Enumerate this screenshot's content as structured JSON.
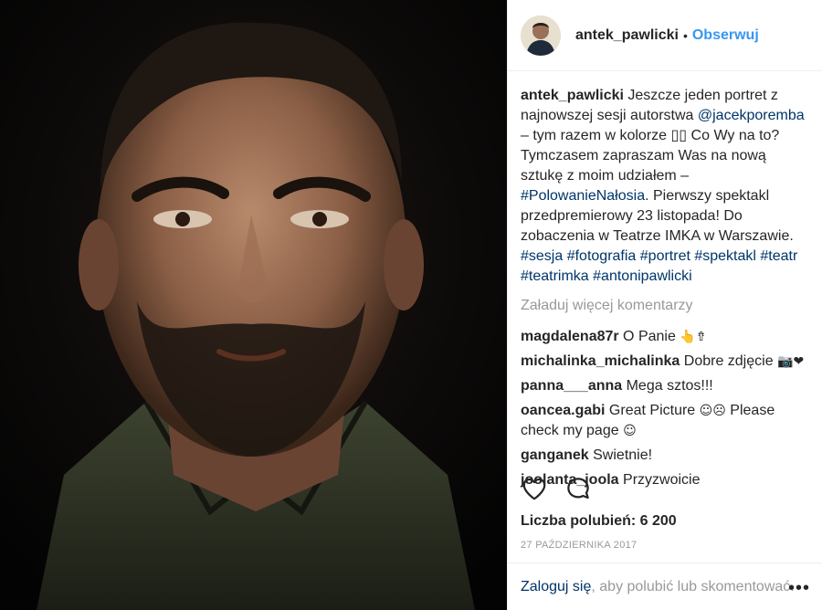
{
  "header": {
    "username": "antek_pawlicki",
    "separator": "•",
    "follow_label": "Obserwuj"
  },
  "caption": {
    "username": "antek_pawlicki",
    "text_1": " Jeszcze jeden portret z najnowszej sesji autorstwa ",
    "mention": "@jacekporemba",
    "text_2": " – tym razem w kolorze ▯▯ Co Wy na to? Tymczasem zapraszam Was na nową sztukę z moim udziałem – ",
    "hashtag_main": "#PolowanieNałosia",
    "text_3": ". Pierwszy spektakl przedpremierowy 23 listopada! Do zobaczenia w Teatrze IMKA w Warszawie.",
    "hashtags": [
      "#sesja",
      "#fotografia",
      "#portret",
      "#spektakl",
      "#teatr",
      "#teatrimka",
      "#antonipawlicki"
    ]
  },
  "load_more": "Załaduj więcej komentarzy",
  "comments": [
    {
      "username": "magdalena87r",
      "text": " O Panie ",
      "emoji": "👆⇮"
    },
    {
      "username": "michalinka_michalinka",
      "text": " Dobre zdjęcie ",
      "emoji": "📷❤"
    },
    {
      "username": "panna___anna",
      "text": " Mega sztos!!!",
      "emoji": ""
    },
    {
      "username": "oancea.gabi",
      "text": " Great Picture ",
      "emoji": "☺☹",
      "text_after": " Please check my page ",
      "emoji_after": "☺"
    },
    {
      "username": "ganganek",
      "text": " Swietnie!",
      "emoji": ""
    },
    {
      "username": "joolanta_joola",
      "text": " Przyzwoicie",
      "emoji": ""
    }
  ],
  "likes": "Liczba polubień: 6 200",
  "date": "27 PAŹDZIERNIKA 2017",
  "footer": {
    "login_label": "Zaloguj się",
    "rest": ", aby polubić lub skomentować.",
    "more": "•••"
  },
  "icons": {
    "like": "heart-icon",
    "comment": "comment-bubble-icon"
  },
  "colors": {
    "link": "#003569",
    "follow": "#3897f0",
    "muted": "#999999"
  }
}
